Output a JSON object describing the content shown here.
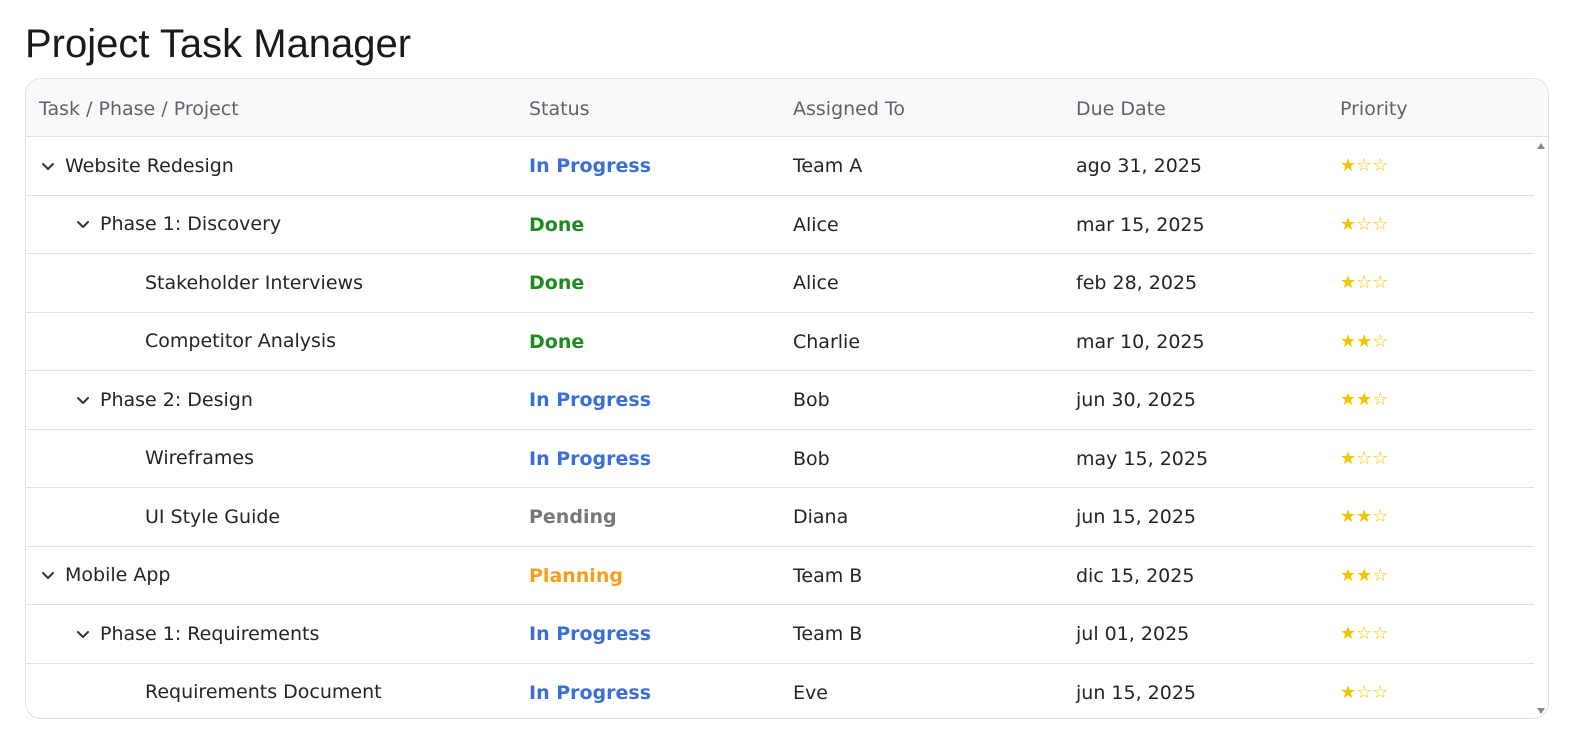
{
  "title": "Project Task Manager",
  "columns": {
    "task": "Task / Phase / Project",
    "status": "Status",
    "assigned": "Assigned To",
    "due": "Due Date",
    "priority": "Priority"
  },
  "status_colors": {
    "In Progress": "#3b6fd8",
    "Done": "#1f8a1f",
    "Pending": "#777777",
    "Planning": "#f59e1b"
  },
  "rows": [
    {
      "level": 0,
      "expandable": true,
      "name": "Website Redesign",
      "status": "In Progress",
      "assigned": "Team A",
      "due": "ago 31, 2025",
      "priority": "★☆☆"
    },
    {
      "level": 1,
      "expandable": true,
      "name": "Phase 1: Discovery",
      "status": "Done",
      "assigned": "Alice",
      "due": "mar 15, 2025",
      "priority": "★☆☆"
    },
    {
      "level": 2,
      "expandable": false,
      "name": "Stakeholder Interviews",
      "status": "Done",
      "assigned": "Alice",
      "due": "feb 28, 2025",
      "priority": "★☆☆"
    },
    {
      "level": 2,
      "expandable": false,
      "name": "Competitor Analysis",
      "status": "Done",
      "assigned": "Charlie",
      "due": "mar 10, 2025",
      "priority": "★★☆"
    },
    {
      "level": 1,
      "expandable": true,
      "name": "Phase 2: Design",
      "status": "In Progress",
      "assigned": "Bob",
      "due": "jun 30, 2025",
      "priority": "★★☆"
    },
    {
      "level": 2,
      "expandable": false,
      "name": "Wireframes",
      "status": "In Progress",
      "assigned": "Bob",
      "due": "may 15, 2025",
      "priority": "★☆☆"
    },
    {
      "level": 2,
      "expandable": false,
      "name": "UI Style Guide",
      "status": "Pending",
      "assigned": "Diana",
      "due": "jun 15, 2025",
      "priority": "★★☆"
    },
    {
      "level": 0,
      "expandable": true,
      "name": "Mobile App",
      "status": "Planning",
      "assigned": "Team B",
      "due": "dic 15, 2025",
      "priority": "★★☆"
    },
    {
      "level": 1,
      "expandable": true,
      "name": "Phase 1: Requirements",
      "status": "In Progress",
      "assigned": "Team B",
      "due": "jul 01, 2025",
      "priority": "★☆☆"
    },
    {
      "level": 2,
      "expandable": false,
      "name": "Requirements Document",
      "status": "In Progress",
      "assigned": "Eve",
      "due": "jun 15, 2025",
      "priority": "★☆☆"
    }
  ],
  "icons": {
    "expander": "chevron-down-icon",
    "scroll_up": "scroll-up-arrow-icon",
    "scroll_down": "scroll-down-arrow-icon"
  }
}
